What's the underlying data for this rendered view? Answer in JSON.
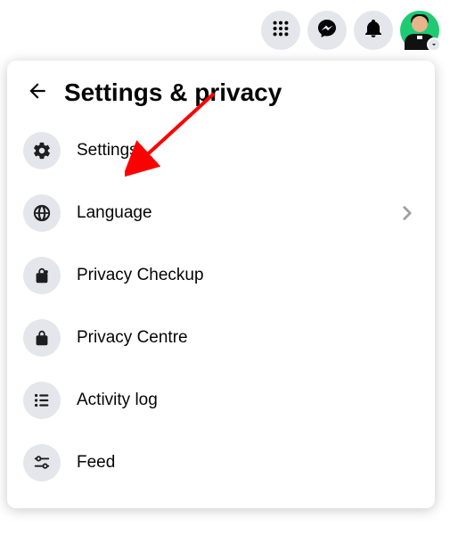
{
  "header": {
    "title": "Settings & privacy"
  },
  "topbar": {
    "menu_icon": "apps-grid-icon",
    "messenger_icon": "messenger-icon",
    "notifications_icon": "bell-icon",
    "account_icon": "avatar"
  },
  "menu": {
    "items": [
      {
        "label": "Settings",
        "icon": "gear-icon",
        "has_chevron": false
      },
      {
        "label": "Language",
        "icon": "globe-icon",
        "has_chevron": true
      },
      {
        "label": "Privacy Checkup",
        "icon": "lock-heart-icon",
        "has_chevron": false
      },
      {
        "label": "Privacy Centre",
        "icon": "lock-icon",
        "has_chevron": false
      },
      {
        "label": "Activity log",
        "icon": "list-icon",
        "has_chevron": false
      },
      {
        "label": "Feed",
        "icon": "sliders-icon",
        "has_chevron": false
      }
    ]
  },
  "colors": {
    "icon_bg": "#e4e6eb",
    "text": "#050505",
    "arrow": "#ff0000",
    "avatar_bg": "#1ecb73"
  }
}
